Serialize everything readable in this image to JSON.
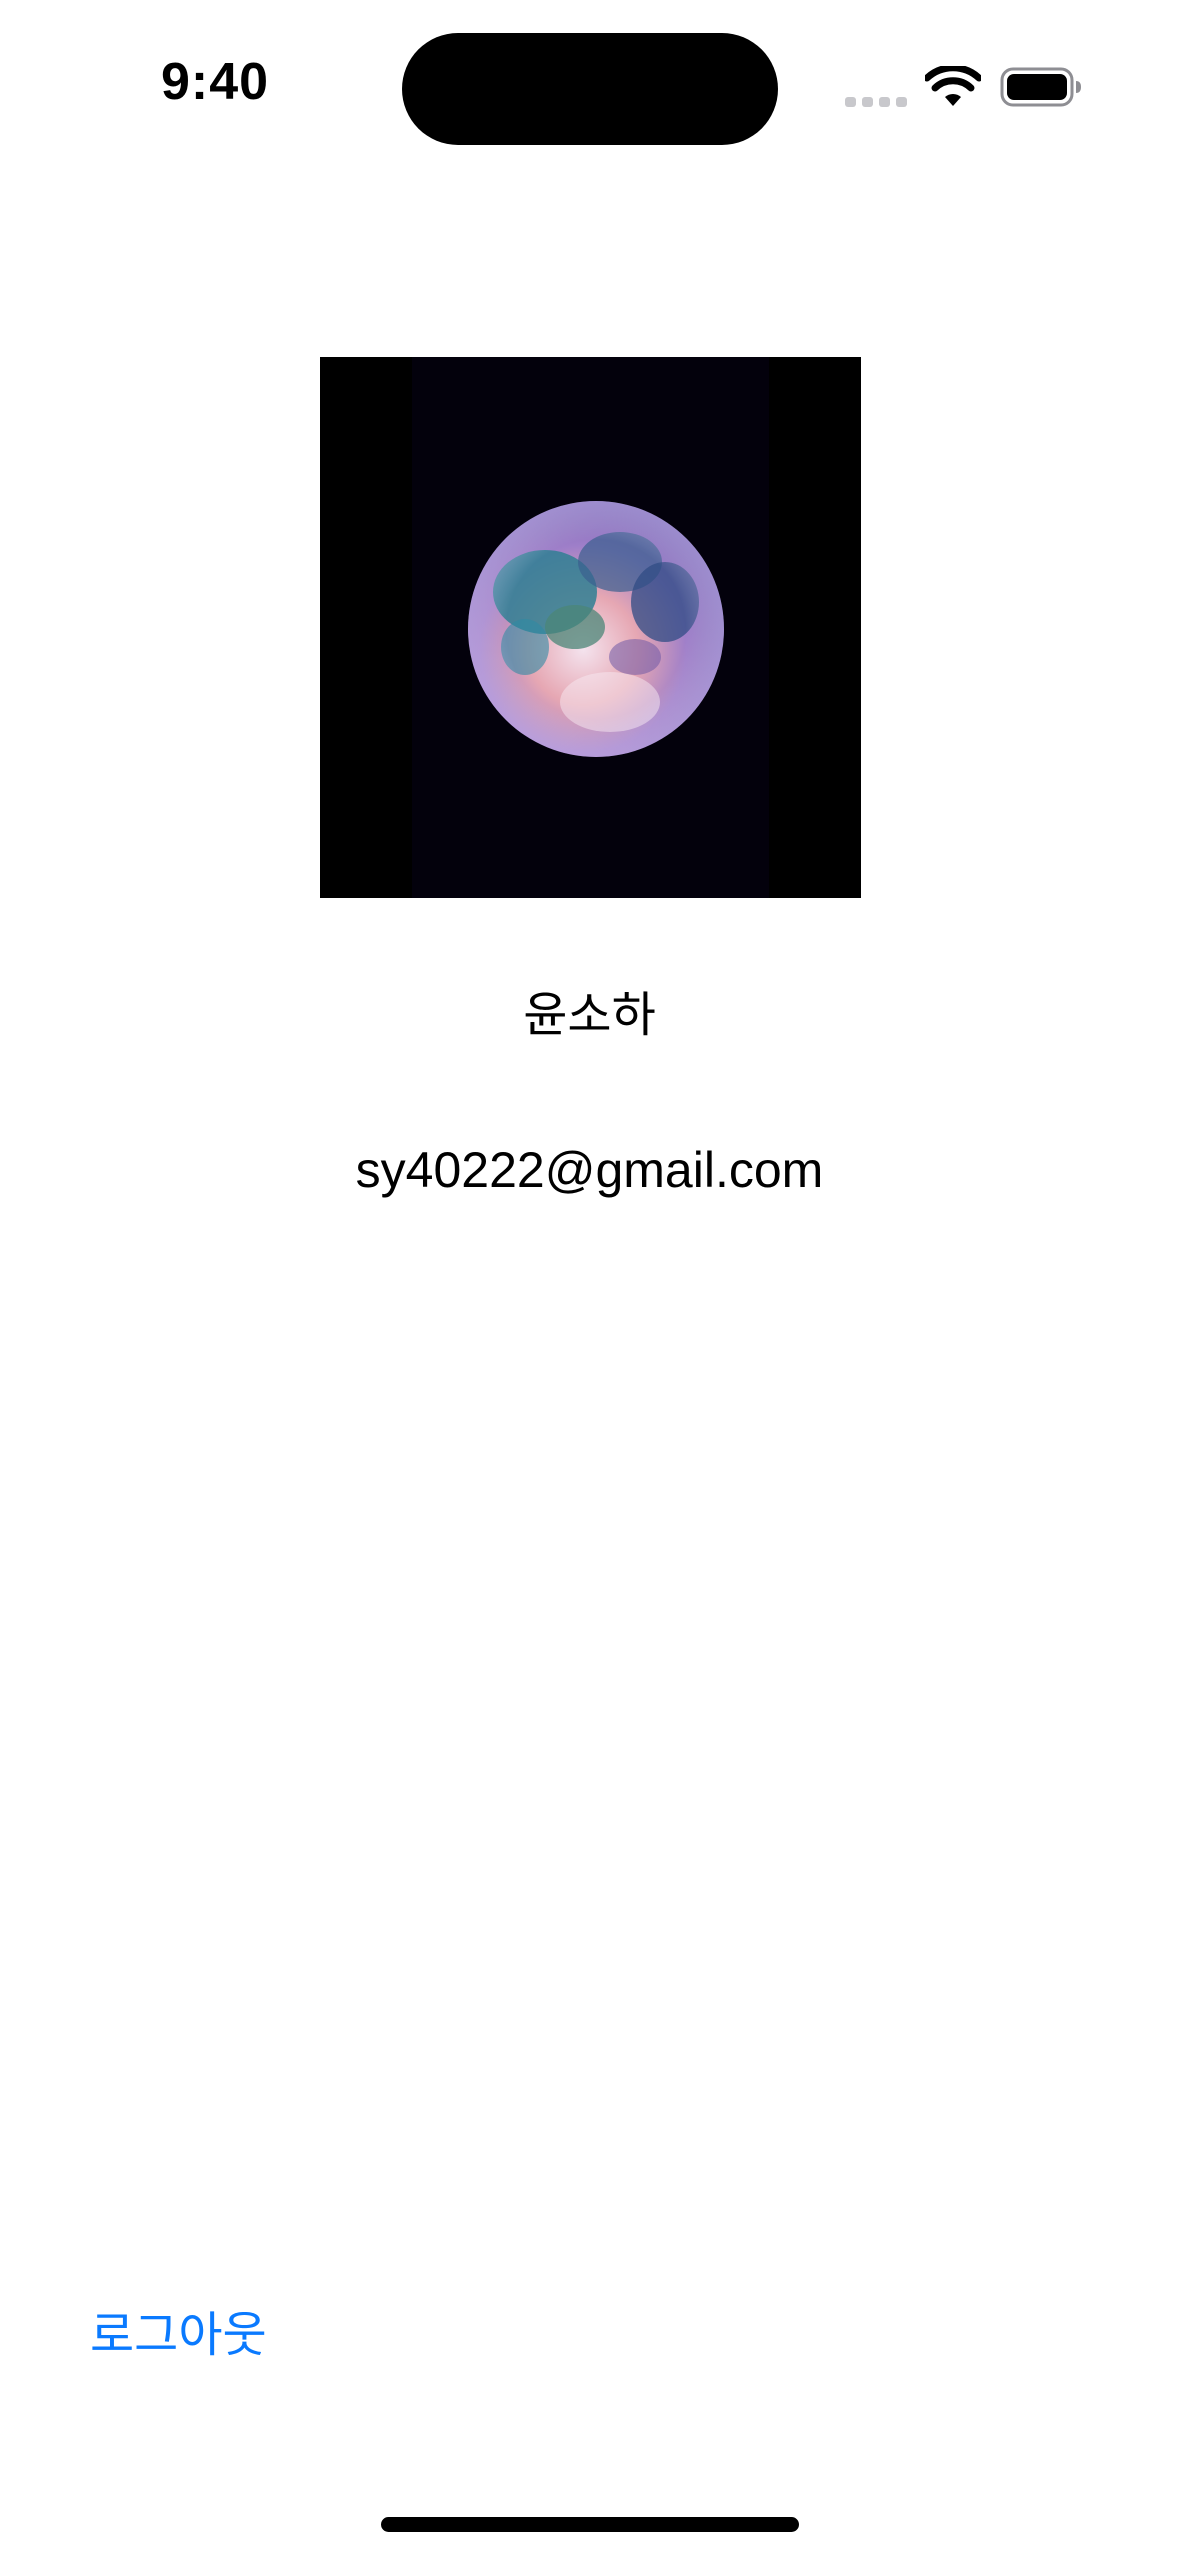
{
  "status_bar": {
    "time": "9:40",
    "icons": [
      "signal-icon",
      "wifi-icon",
      "battery-icon"
    ]
  },
  "profile": {
    "image": "moon-photo",
    "name": "윤소하",
    "email": "sy40222@gmail.com"
  },
  "actions": {
    "logout_label": "로그아웃"
  },
  "colors": {
    "background": "#ffffff",
    "text": "#000000",
    "accent": "#0a7aff"
  }
}
